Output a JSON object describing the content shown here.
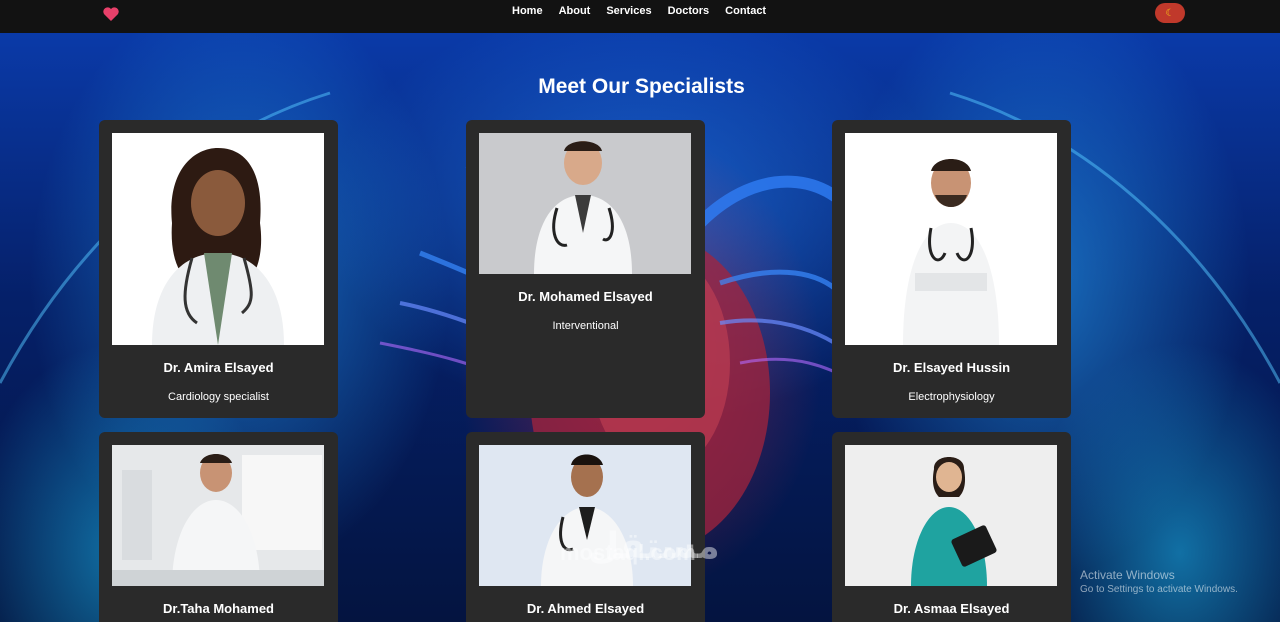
{
  "nav": {
    "logo_icon": "heart-icon",
    "links": [
      "Home",
      "About",
      "Services",
      "Doctors",
      "Contact"
    ],
    "theme_toggle_icon": "moon-icon",
    "accent": "#c0392b"
  },
  "section": {
    "title": "Meet Our Specialists"
  },
  "doctors": [
    {
      "name": "Dr. Amira Elsayed",
      "specialty": "Cardiology specialist"
    },
    {
      "name": "Dr. Mohamed Elsayed",
      "specialty": "Interventional"
    },
    {
      "name": "Dr. Elsayed Hussin",
      "specialty": "Electrophysiology"
    },
    {
      "name": "Dr.Taha Mohamed",
      "specialty": ""
    },
    {
      "name": "Dr. Ahmed Elsayed",
      "specialty": ""
    },
    {
      "name": "Dr. Asmaa Elsayed",
      "specialty": ""
    }
  ],
  "watermark": {
    "arabic": "مستقل",
    "latin": "mostaql.com"
  },
  "activation": {
    "title": "Activate Windows",
    "subtitle": "Go to Settings to activate Windows."
  }
}
